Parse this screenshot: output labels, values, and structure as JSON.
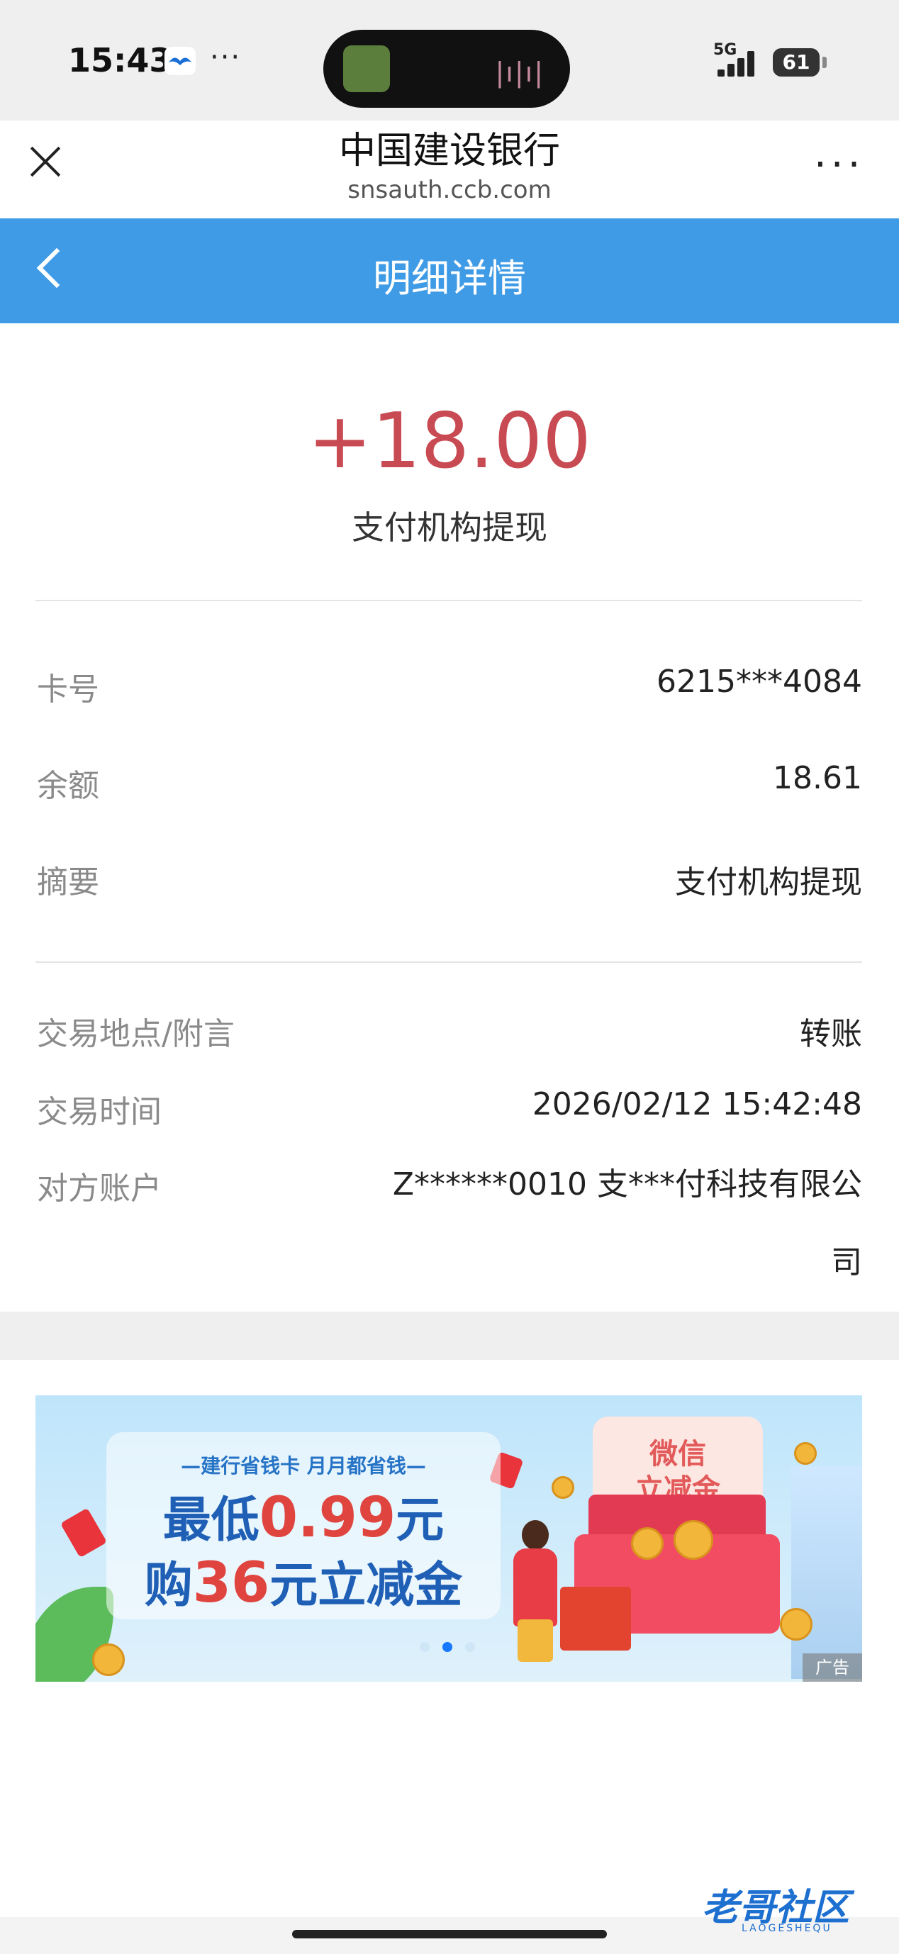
{
  "status_bar": {
    "time": "15:43",
    "dots": "···",
    "network": "5G",
    "battery": "61"
  },
  "browser": {
    "title": "中国建设银行",
    "url": "snsauth.ccb.com",
    "more": "···"
  },
  "header": {
    "title": "明细详情"
  },
  "transaction": {
    "amount": "+18.00",
    "description": "支付机构提现"
  },
  "details_group1": [
    {
      "label": "卡号",
      "value": "6215***4084"
    },
    {
      "label": "余额",
      "value": "18.61"
    },
    {
      "label": "摘要",
      "value": "支付机构提现"
    }
  ],
  "details_group2": [
    {
      "label": "交易地点/附言",
      "value": "转账"
    },
    {
      "label": "交易时间",
      "value": "2026/02/12 15:42:48"
    },
    {
      "label": "对方账户",
      "value": "Z******0010 支***付科技有限公司"
    }
  ],
  "banner": {
    "tagline": "—建行省钱卡 月月都省钱—",
    "line1_prefix": "最低",
    "line1_num": "0.99",
    "line1_suffix": "元",
    "line2_prefix": "购",
    "line2_num": "36",
    "line2_suffix": "元立减金",
    "wechat_line1": "微信",
    "wechat_line2": "立减金",
    "ad_label": "广告",
    "carousel_active_index": 1,
    "carousel_count": 3
  },
  "watermark": {
    "text": "老哥社区",
    "sub": "LAOGESHEQU"
  },
  "colors": {
    "header_blue": "#3f9be5",
    "amount_red": "#c84a52",
    "carousel_active": "#1677ff"
  }
}
